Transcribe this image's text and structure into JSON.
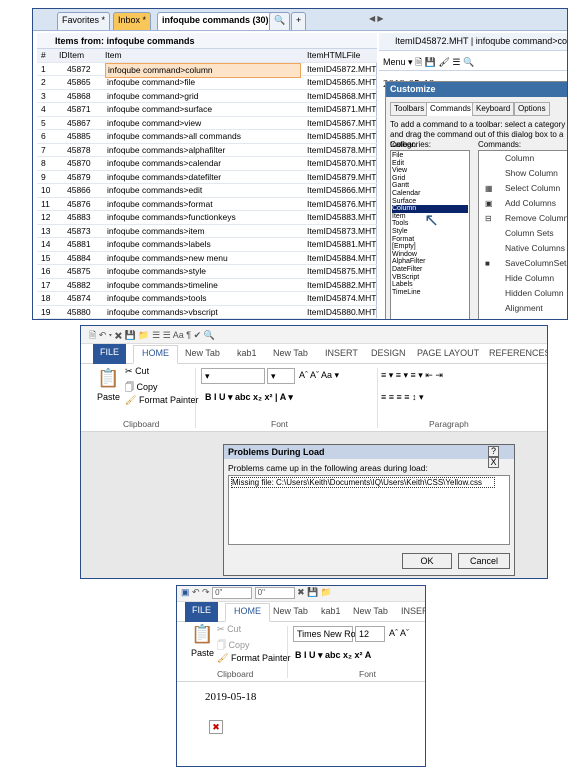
{
  "window1": {
    "tabs": [
      "Favorites *",
      "Inbox *",
      "infoqube commands (30)",
      "+"
    ],
    "items_from_label": "Items from:",
    "items_from_value": "infoqube commands",
    "columns": [
      "#",
      "IDItem",
      "Item",
      "ItemHTMLFile"
    ],
    "rows": [
      [
        "1",
        "45872",
        "infoqube command>column",
        "ItemID45872.MHT"
      ],
      [
        "2",
        "45865",
        "infoqube command>file",
        "ItemID45865.MHT"
      ],
      [
        "3",
        "45868",
        "infoqube command>grid",
        "ItemID45868.MHT"
      ],
      [
        "4",
        "45871",
        "infoqube command>surface",
        "ItemID45871.MHT"
      ],
      [
        "5",
        "45867",
        "infoqube command>view",
        "ItemID45867.MHT"
      ],
      [
        "6",
        "45885",
        "infoqube commands>all commands",
        "ItemID45885.MHT"
      ],
      [
        "7",
        "45878",
        "infoqube commands>alphafilter",
        "ItemID45878.MHT"
      ],
      [
        "8",
        "45870",
        "infoqube commands>calendar",
        "ItemID45870.MHT"
      ],
      [
        "9",
        "45879",
        "infoqube commands>datefilter",
        "ItemID45879.MHT"
      ],
      [
        "10",
        "45866",
        "infoqube commands>edit",
        "ItemID45866.MHT"
      ],
      [
        "11",
        "45876",
        "infoqube commands>format",
        "ItemID45876.MHT"
      ],
      [
        "12",
        "45883",
        "infoqube commands>functionkeys",
        "ItemID45883.MHT"
      ],
      [
        "13",
        "45873",
        "infoqube commands>item",
        "ItemID45873.MHT"
      ],
      [
        "14",
        "45881",
        "infoqube commands>labels",
        "ItemID45881.MHT"
      ],
      [
        "15",
        "45884",
        "infoqube commands>new menu",
        "ItemID45884.MHT"
      ],
      [
        "16",
        "45875",
        "infoqube commands>style",
        "ItemID45875.MHT"
      ],
      [
        "17",
        "45882",
        "infoqube commands>timeline",
        "ItemID45882.MHT"
      ],
      [
        "18",
        "45874",
        "infoqube commands>tools",
        "ItemID45874.MHT"
      ],
      [
        "19",
        "45880",
        "infoqube commands>vbscript",
        "ItemID45880.MHT"
      ]
    ],
    "selected_row": 0,
    "right_title": "ItemID45872.MHT | infoqube command>column",
    "menu_label": "Menu",
    "date": "2019-05-18",
    "customize": {
      "title": "Customize",
      "tabs": [
        "Toolbars",
        "Commands",
        "Keyboard",
        "Options"
      ],
      "description": "To add a command to a toolbar: select a category and drag the command out of this dialog box to a toolbar.",
      "categories_label": "Categories:",
      "commands_label": "Commands:",
      "categories": [
        "File",
        "Edit",
        "View",
        "Grid",
        "Gantt",
        "Calendar",
        "Surface",
        "Column",
        "Item",
        "Tools",
        "Style",
        "Format",
        "[Empty]",
        "Window",
        "AlphaFilter",
        "DateFilter",
        "VBScript",
        "Labels",
        "TimeLine"
      ],
      "selected_category": "Column",
      "commands": [
        "Column",
        "Show Column",
        "Select Column",
        "Add Columns",
        "Remove Column",
        "Column Sets",
        "Native Columns",
        "SaveColumnSet",
        "Hide Column",
        "Hidden Column",
        "Alignment"
      ]
    }
  },
  "window2": {
    "ribbon_tabs": [
      "FILE",
      "HOME",
      "New Tab",
      "kab1",
      "New Tab",
      "INSERT",
      "DESIGN",
      "PAGE LAYOUT",
      "REFERENCES"
    ],
    "clipboard": {
      "paste": "Paste",
      "cut": "Cut",
      "copy": "Copy",
      "format_painter": "Format Painter",
      "group": "Clipboard"
    },
    "font_group": "Font",
    "paragraph_group": "Paragraph",
    "dialog": {
      "title": "Problems During Load",
      "message": "Problems came up in the following areas during load:",
      "entry": "Missing file: C:\\Users\\Keith\\Documents\\IQ\\Users\\Keith\\CSS\\Yellow.css",
      "ok": "OK",
      "cancel": "Cancel",
      "help": "?",
      "close": "X"
    }
  },
  "window3": {
    "ribbon_tabs": [
      "FILE",
      "HOME",
      "New Tab",
      "kab1",
      "New Tab",
      "INSERT"
    ],
    "font_name": "Times New Ro",
    "font_size": "12",
    "style_box_1": "0\"",
    "style_box_2": "0\"",
    "clipboard": {
      "paste": "Paste",
      "cut": "Cut",
      "copy": "Copy",
      "format_painter": "Format Painter",
      "group": "Clipboard"
    },
    "font_group": "Font",
    "date": "2019-05-18"
  }
}
